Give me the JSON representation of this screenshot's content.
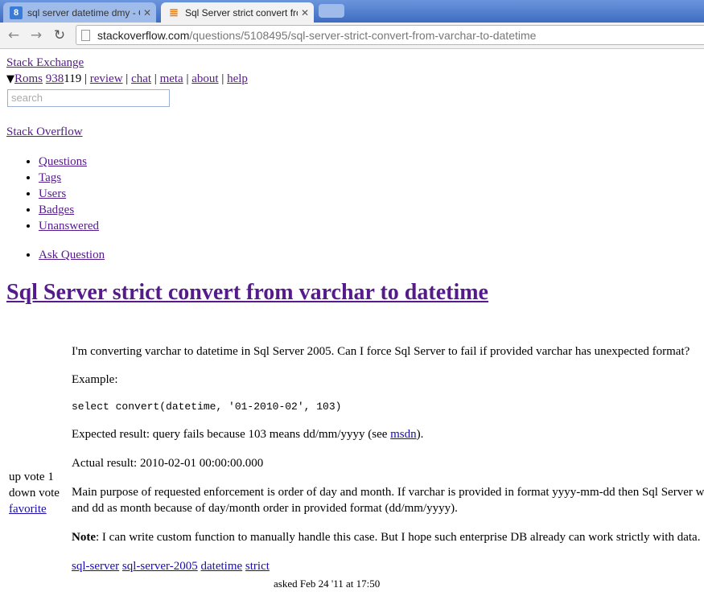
{
  "browser": {
    "tabs": [
      {
        "label": "sql server datetime dmy - Go",
        "favicon": "google-icon"
      },
      {
        "label": "Sql Server strict convert from",
        "favicon": "stackoverflow-icon"
      }
    ],
    "url_host": "stackoverflow.com",
    "url_path": "/questions/5108495/sql-server-strict-convert-from-varchar-to-datetime"
  },
  "topbar": {
    "site_link": "Stack Exchange",
    "user": "Roms",
    "rep": "938",
    "badges": "119",
    "links": [
      "review",
      "chat",
      "meta",
      "about",
      "help"
    ],
    "sep": "|",
    "search_placeholder": "search"
  },
  "site_name": "Stack Overflow",
  "nav": [
    "Questions",
    "Tags",
    "Users",
    "Badges",
    "Unanswered"
  ],
  "ask_link": "Ask Question",
  "question": {
    "title": "Sql Server strict convert from varchar to datetime",
    "p1": "I'm converting varchar to datetime in Sql Server 2005. Can I force Sql Server to fail if provided varchar has unexpected format?",
    "p2": "Example:",
    "code": "select convert(datetime, '01-2010-02', 103)",
    "p3_before": "Expected result: query fails because 103 means dd/mm/yyyy (see ",
    "p3_link": "msdn",
    "p3_after": ").",
    "p4": "Actual result: 2010-02-01 00:00:00.000",
    "p5_line1": "Main purpose of requested enforcement is order of day and month. If varchar is provided in format yyyy-mm-dd then Sql Server w",
    "p5_line2": "and dd as month because of day/month order in provided format (dd/mm/yyyy).",
    "note_label": "Note",
    "note_text": ": I can write custom function to manually handle this case. But I hope such enterprise DB already can work strictly with data.",
    "tags": [
      "sql-server",
      "sql-server-2005",
      "datetime",
      "strict"
    ],
    "asked_fragment": "asked Feb 24 '11 at 17:50"
  },
  "vote": {
    "up_label": "up vote",
    "score": "1",
    "down_label": "down vote",
    "favorite": "favorite"
  }
}
